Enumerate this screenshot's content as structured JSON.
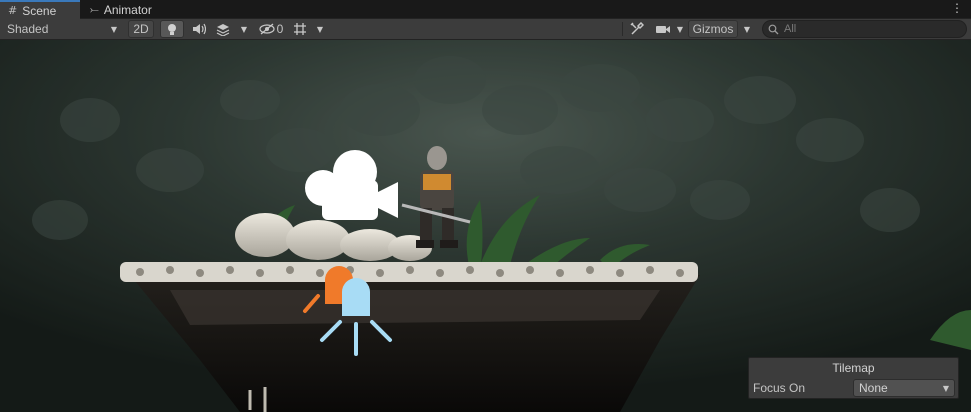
{
  "tabs": [
    {
      "label": "Scene",
      "icon": "grid-icon",
      "active": true
    },
    {
      "label": "Animator",
      "icon": "animator-icon",
      "active": false
    }
  ],
  "toolbar": {
    "draw_mode": "Shaded",
    "mode_2d": "2D",
    "hidden_count": "0",
    "gizmos": "Gizmos",
    "search_placeholder": "All"
  },
  "icons": {
    "lighting": "lightbulb-icon",
    "audio": "speaker-icon",
    "effects": "effects-layers-icon",
    "visibility": "eye-slash-icon",
    "grid": "grid-snap-icon",
    "tools": "tools-icon",
    "camera": "camera-icon",
    "search": "search-icon",
    "menu": "kebab-menu-icon"
  },
  "overlay": {
    "title": "Tilemap",
    "focus_label": "Focus On",
    "focus_value": "None"
  },
  "colors": {
    "accent": "#3a79bb",
    "toolbar_bg": "#3c3c3c",
    "camera_gizmo": "#ffffff",
    "light_gizmo_orange": "#f07a2a",
    "light_gizmo_blue": "#a8dcf5"
  }
}
